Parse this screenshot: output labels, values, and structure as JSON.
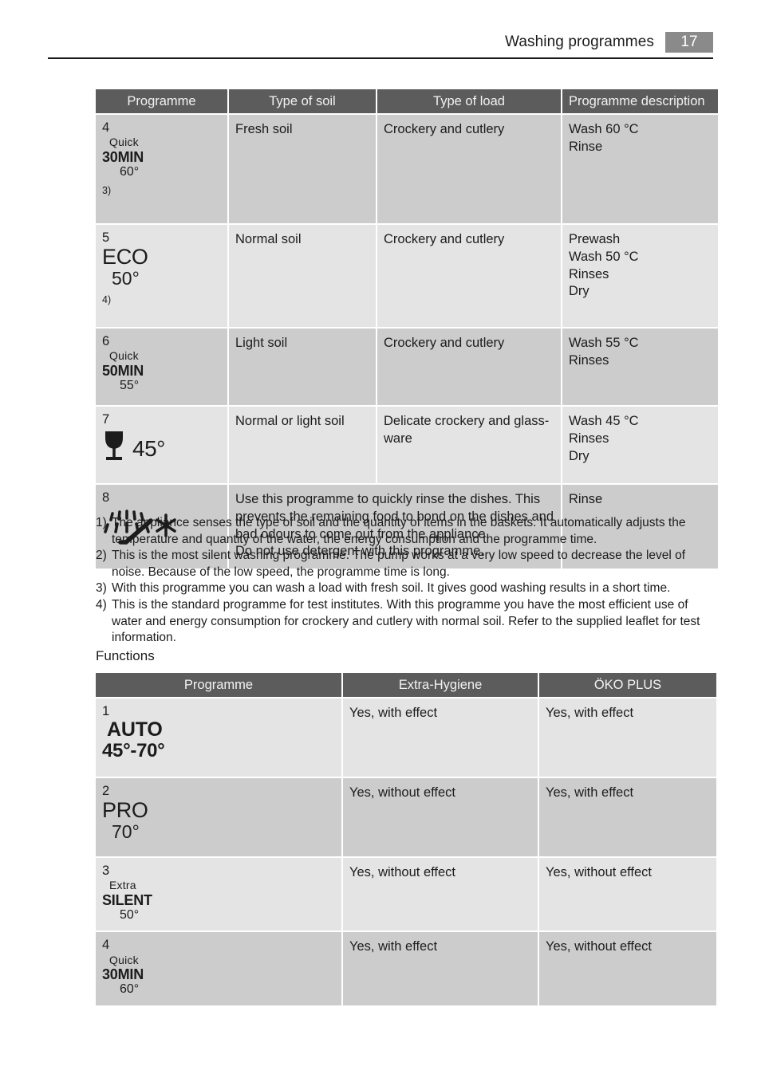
{
  "header": {
    "title": "Washing programmes",
    "page_number": "17"
  },
  "programmes_table": {
    "columns": [
      "Programme",
      "Type of soil",
      "Type of load",
      "Programme description"
    ],
    "rows": [
      {
        "shade": "dark",
        "number": "4",
        "label_line1": "Quick",
        "label_line2": "30MIN",
        "label_line3": "60°",
        "footnote_ref": "3)",
        "type_of_soil": "Fresh soil",
        "type_of_load": "Crockery and cutlery",
        "description": "Wash 60 °C\nRinse"
      },
      {
        "shade": "light",
        "number": "5",
        "label_big": "ECO",
        "label_big_sub": "50°",
        "footnote_ref": "4)",
        "type_of_soil": "Normal soil",
        "type_of_load": "Crockery and cutlery",
        "description": "Prewash\nWash 50 °C\nRinses\nDry"
      },
      {
        "shade": "dark",
        "number": "6",
        "label_line1": "Quick",
        "label_line2": "50MIN",
        "label_line3": "55°",
        "type_of_soil": "Light soil",
        "type_of_load": "Crockery and cutlery",
        "description": "Wash 55 °C\nRinses"
      },
      {
        "shade": "light",
        "number": "7",
        "icon": "wine-glass-icon",
        "icon_degrees": "45°",
        "type_of_soil": "Normal or light soil",
        "type_of_load": "Delicate crockery and glass-ware",
        "description": "Wash 45 °C\nRinses\nDry"
      },
      {
        "shade": "dark",
        "number": "8",
        "icon": "spray-rinse-icon",
        "merged_description": "Use this programme to quickly rinse the dishes. This prevents the remaining food to bond on the dishes and bad odours to come out from the appliance.\nDo not use detergent with this programme.",
        "description": "Rinse"
      }
    ]
  },
  "footnotes": [
    {
      "marker": "1)",
      "text": "The appliance senses the type of soil and the quantity of items in the baskets. It automatically adjusts the temperature and quantity of the water, the energy consumption and the programme time."
    },
    {
      "marker": "2)",
      "text": "This is the most silent washing programme. The pump works at a very low speed to decrease the level of noise. Because of the low speed, the programme time is long."
    },
    {
      "marker": "3)",
      "text": "With this programme you can wash a load with fresh soil. It gives good washing results in a short time."
    },
    {
      "marker": "4)",
      "text": "This is the standard programme for test institutes. With this programme you have the most efficient use of water and energy consumption for crockery and cutlery with normal soil. Refer to the supplied leaflet for test information."
    }
  ],
  "functions_section": {
    "heading": "Functions",
    "columns": [
      "Programme",
      "Extra-Hygiene",
      "ÖKO PLUS"
    ],
    "rows": [
      {
        "shade": "light",
        "number": "1",
        "label_big": "AUTO",
        "label_big_sub": "45°-70°",
        "extra_hygiene": "Yes, with effect",
        "oko_plus": "Yes, with effect"
      },
      {
        "shade": "dark",
        "number": "2",
        "label_big": "PRO",
        "label_big_sub": "70°",
        "extra_hygiene": "Yes, without effect",
        "oko_plus": "Yes, with effect"
      },
      {
        "shade": "light",
        "number": "3",
        "label_line1": "Extra",
        "label_line2": "SILENT",
        "label_line3": "50°",
        "extra_hygiene": "Yes, without effect",
        "oko_plus": "Yes, without effect"
      },
      {
        "shade": "dark",
        "number": "4",
        "label_line1": "Quick",
        "label_line2": "30MIN",
        "label_line3": "60°",
        "extra_hygiene": "Yes, with effect",
        "oko_plus": "Yes, without effect"
      }
    ]
  },
  "colors": {
    "header_band": "#5c5c5c",
    "row_dark": "#cccccc",
    "row_light": "#e4e4e4",
    "page_badge": "#8a8a8a",
    "text": "#1c1c1c"
  }
}
